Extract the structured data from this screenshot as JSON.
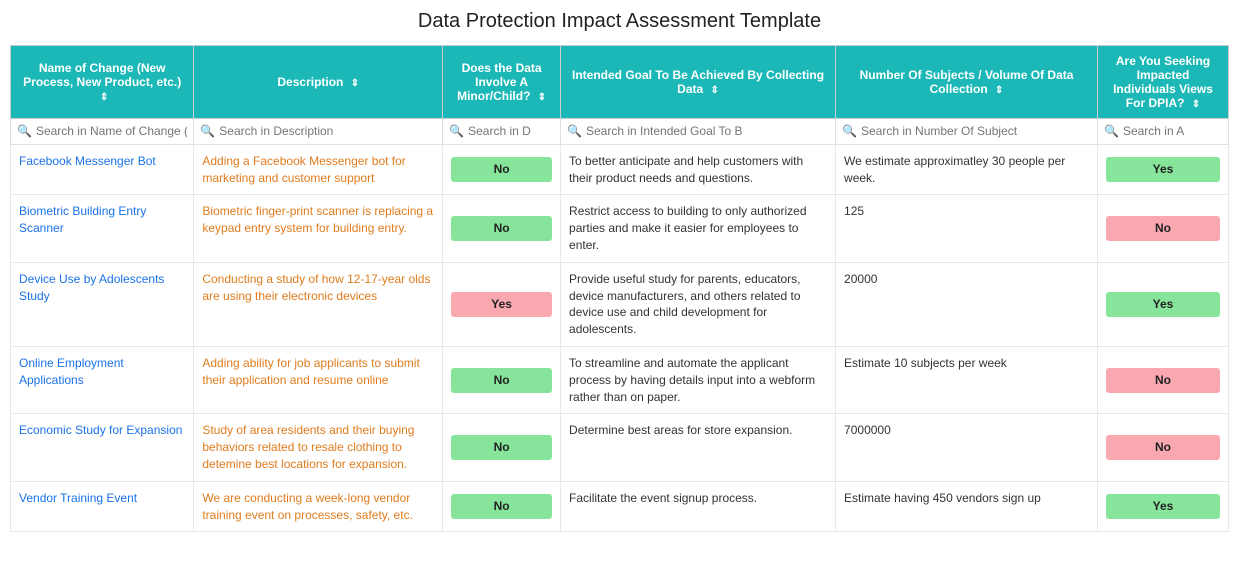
{
  "title": "Data Protection Impact Assessment Template",
  "columns": [
    {
      "id": "name",
      "label": "Name of Change (New Process, New Product, etc.)",
      "sortable": true
    },
    {
      "id": "desc",
      "label": "Description",
      "sortable": true
    },
    {
      "id": "minor",
      "label": "Does the Data Involve A Minor/Child?",
      "sortable": true
    },
    {
      "id": "goal",
      "label": "Intended Goal To Be Achieved By Collecting Data",
      "sortable": true
    },
    {
      "id": "num",
      "label": "Number Of Subjects / Volume Of Data Collection",
      "sortable": true
    },
    {
      "id": "seek",
      "label": "Are You Seeking Impacted Individuals Views For DPIA?",
      "sortable": true
    }
  ],
  "search": {
    "name": "Search in Name of Change (N",
    "desc": "Search in Description",
    "minor": "Search in D",
    "goal": "Search in Intended Goal To B",
    "num": "Search in Number Of Subject",
    "seek": "Search in A"
  },
  "rows": [
    {
      "name": "Facebook Messenger Bot",
      "desc": "Adding a Facebook Messenger bot for marketing and customer support",
      "minor": "No",
      "minor_type": "green",
      "goal": "To better anticipate and help customers with their product needs and questions.",
      "num": "We estimate approximatley 30 people per week.",
      "seek": "Yes",
      "seek_type": "green"
    },
    {
      "name": "Biometric Building Entry Scanner",
      "desc": "Biometric finger-print scanner is replacing a keypad entry system for building entry.",
      "minor": "No",
      "minor_type": "green",
      "goal": "Restrict access to building to only authorized parties and make it easier for employees to enter.",
      "num": "125",
      "seek": "No",
      "seek_type": "pink"
    },
    {
      "name": "Device Use by Adolescents Study",
      "desc": "Conducting a study of how 12-17-year olds are using their electronic devices",
      "minor": "Yes",
      "minor_type": "pink",
      "goal": "Provide useful study for parents, educators, device manufacturers, and others related to device use and child development for adolescents.",
      "num": "20000",
      "seek": "Yes",
      "seek_type": "green"
    },
    {
      "name": "Online Employment Applications",
      "desc": "Adding ability for job applicants to submit their application and resume online",
      "minor": "No",
      "minor_type": "green",
      "goal": "To streamline and automate the applicant process by having details input into a webform rather than on paper.",
      "num": "Estimate 10 subjects per week",
      "seek": "No",
      "seek_type": "pink"
    },
    {
      "name": "Economic Study for Expansion",
      "desc": "Study of area residents and their buying behaviors related to resale clothing to detemine best locations for expansion.",
      "minor": "No",
      "minor_type": "green",
      "goal": "Determine best areas for store expansion.",
      "num": "7000000",
      "seek": "No",
      "seek_type": "pink"
    },
    {
      "name": "Vendor Training Event",
      "desc": "We are conducting a week-long vendor training event on processes, safety, etc.",
      "minor": "No",
      "minor_type": "green",
      "goal": "Facilitate the event signup process.",
      "num": "Estimate having 450 vendors sign up",
      "seek": "Yes",
      "seek_type": "green"
    }
  ]
}
